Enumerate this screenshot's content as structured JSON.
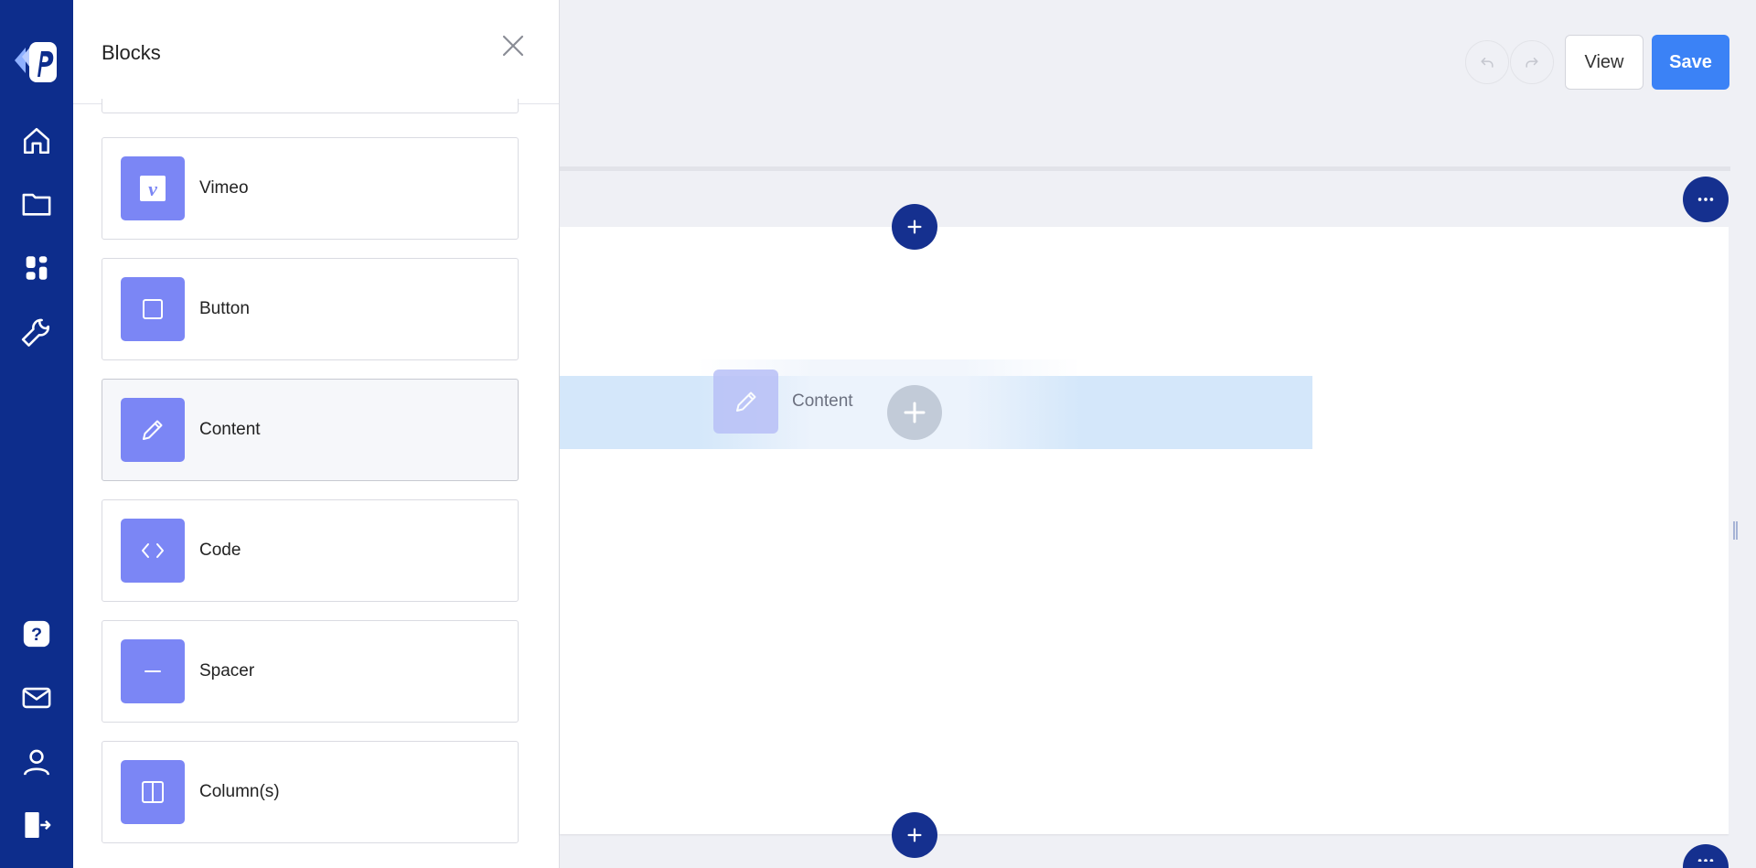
{
  "panel": {
    "title": "Blocks",
    "blocks": [
      {
        "label": "Vimeo",
        "icon": "vimeo-icon"
      },
      {
        "label": "Button",
        "icon": "square-icon"
      },
      {
        "label": "Content",
        "icon": "pencil-icon"
      },
      {
        "label": "Code",
        "icon": "code-icon"
      },
      {
        "label": "Spacer",
        "icon": "minus-icon"
      },
      {
        "label": "Column(s)",
        "icon": "columns-icon"
      }
    ]
  },
  "toolbar": {
    "view_label": "View",
    "save_label": "Save"
  },
  "canvas": {
    "dragging_label": "Content"
  },
  "colors": {
    "nav": "#0d2d8c",
    "block_icon_bg": "#7b86f5",
    "primary": "#3b82f6",
    "round_button": "#15308f",
    "dropzone": "#d4e7fa"
  }
}
